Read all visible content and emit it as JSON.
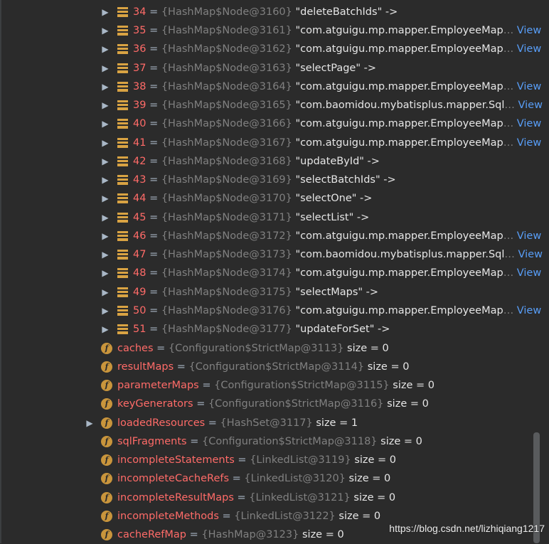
{
  "map_entries": [
    {
      "index": "34",
      "ref": "{HashMap$Node@3160}",
      "value": "\"deleteBatchIds\" ->",
      "view": ""
    },
    {
      "index": "35",
      "ref": "{HashMap$Node@3161}",
      "value": "\"com.atguigu.mp.mapper.EmployeeMap",
      "view": "View"
    },
    {
      "index": "36",
      "ref": "{HashMap$Node@3162}",
      "value": "\"com.atguigu.mp.mapper.EmployeeMap",
      "view": "View"
    },
    {
      "index": "37",
      "ref": "{HashMap$Node@3163}",
      "value": "\"selectPage\" ->",
      "view": ""
    },
    {
      "index": "38",
      "ref": "{HashMap$Node@3164}",
      "value": "\"com.atguigu.mp.mapper.EmployeeMap",
      "view": "View"
    },
    {
      "index": "39",
      "ref": "{HashMap$Node@3165}",
      "value": "\"com.baomidou.mybatisplus.mapper.Sql",
      "view": "View"
    },
    {
      "index": "40",
      "ref": "{HashMap$Node@3166}",
      "value": "\"com.atguigu.mp.mapper.EmployeeMap",
      "view": "View"
    },
    {
      "index": "41",
      "ref": "{HashMap$Node@3167}",
      "value": "\"com.atguigu.mp.mapper.EmployeeMap",
      "view": "View"
    },
    {
      "index": "42",
      "ref": "{HashMap$Node@3168}",
      "value": "\"updateById\" ->",
      "view": ""
    },
    {
      "index": "43",
      "ref": "{HashMap$Node@3169}",
      "value": "\"selectBatchIds\" ->",
      "view": ""
    },
    {
      "index": "44",
      "ref": "{HashMap$Node@3170}",
      "value": "\"selectOne\" ->",
      "view": ""
    },
    {
      "index": "45",
      "ref": "{HashMap$Node@3171}",
      "value": "\"selectList\" ->",
      "view": ""
    },
    {
      "index": "46",
      "ref": "{HashMap$Node@3172}",
      "value": "\"com.atguigu.mp.mapper.EmployeeMap",
      "view": "View"
    },
    {
      "index": "47",
      "ref": "{HashMap$Node@3173}",
      "value": "\"com.baomidou.mybatisplus.mapper.Sql",
      "view": "View"
    },
    {
      "index": "48",
      "ref": "{HashMap$Node@3174}",
      "value": "\"com.atguigu.mp.mapper.EmployeeMap",
      "view": "View"
    },
    {
      "index": "49",
      "ref": "{HashMap$Node@3175}",
      "value": "\"selectMaps\" ->",
      "view": ""
    },
    {
      "index": "50",
      "ref": "{HashMap$Node@3176}",
      "value": "\"com.atguigu.mp.mapper.EmployeeMap",
      "view": "View"
    },
    {
      "index": "51",
      "ref": "{HashMap$Node@3177}",
      "value": "\"updateForSet\" ->",
      "view": ""
    }
  ],
  "fields": [
    {
      "name": "caches",
      "ref": "{Configuration$StrictMap@3113}",
      "size": "size = 0",
      "expandable": false
    },
    {
      "name": "resultMaps",
      "ref": "{Configuration$StrictMap@3114}",
      "size": "size = 0",
      "expandable": false
    },
    {
      "name": "parameterMaps",
      "ref": "{Configuration$StrictMap@3115}",
      "size": "size = 0",
      "expandable": false
    },
    {
      "name": "keyGenerators",
      "ref": "{Configuration$StrictMap@3116}",
      "size": "size = 0",
      "expandable": false
    },
    {
      "name": "loadedResources",
      "ref": "{HashSet@3117}",
      "size": "size = 1",
      "expandable": true
    },
    {
      "name": "sqlFragments",
      "ref": "{Configuration$StrictMap@3118}",
      "size": "size = 0",
      "expandable": false
    },
    {
      "name": "incompleteStatements",
      "ref": "{LinkedList@3119}",
      "size": "size = 0",
      "expandable": false
    },
    {
      "name": "incompleteCacheRefs",
      "ref": "{LinkedList@3120}",
      "size": "size = 0",
      "expandable": false
    },
    {
      "name": "incompleteResultMaps",
      "ref": "{LinkedList@3121}",
      "size": "size = 0",
      "expandable": false
    },
    {
      "name": "incompleteMethods",
      "ref": "{LinkedList@3122}",
      "size": "size = 0",
      "expandable": false
    },
    {
      "name": "cacheRefMap",
      "ref": "{HashMap@3123}",
      "size": "size = 0",
      "expandable": false
    }
  ],
  "symbols": {
    "expand_arrow": "▶",
    "equals": "=",
    "ellipsis": "…",
    "field_icon_letter": "f"
  },
  "icons": {
    "map_entry": "hashmap-entry-icon",
    "field": "field-icon",
    "expand": "expand-arrow-icon"
  },
  "colors": {
    "background": "#2b2b2b",
    "name": "#ff6b68",
    "reference": "#808080",
    "value": "#e6e6e6",
    "link": "#589df6",
    "icon": "#d9a343"
  },
  "watermark": "https://blog.csdn.net/lizhiqiang1217"
}
